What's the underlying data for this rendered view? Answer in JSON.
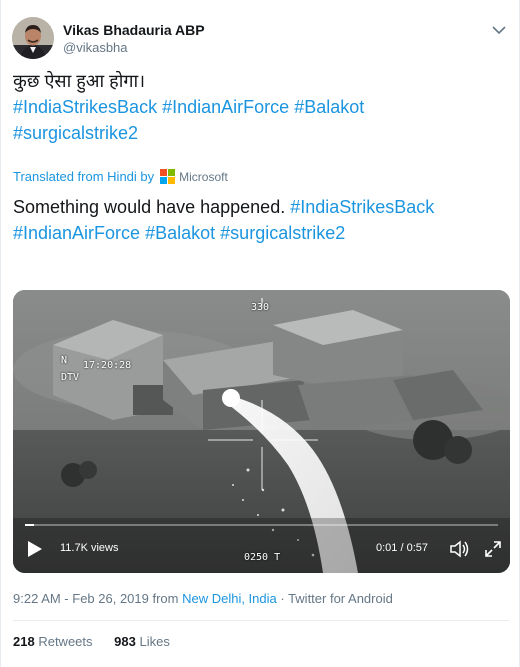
{
  "author": {
    "name": "Vikas Bhadauria ABP",
    "handle": "@vikasbha"
  },
  "tweet": {
    "text_line1": "कुछ ऐसा हुआ होगा।",
    "hashtags_line1": [
      "#IndiaStrikesBack",
      "#IndianAirForce",
      "#Balakot"
    ],
    "hashtags_line2": [
      "#surgicalstrike2"
    ]
  },
  "translation": {
    "label": "Translated from Hindi by",
    "provider": "Microsoft",
    "text_line1": "Something would have happened.",
    "hashtags_line1": [
      "#IndiaStrikesBack",
      "#IndianAirForce",
      "#Balakot"
    ],
    "hashtags_line2": [
      "#surgicalstrike2"
    ]
  },
  "video": {
    "overlay_heading": "330",
    "overlay_dir": "N",
    "overlay_clock": "17:20:28",
    "overlay_mode": "DTV",
    "overlay_bottom": "0250  T",
    "views": "11.7K views",
    "time": "0:01 / 0:57",
    "progress": 0.02
  },
  "meta": {
    "time": "9:22 AM - Feb 26, 2019 from ",
    "location": "New Delhi, India",
    "source": " · Twitter for Android"
  },
  "stats": {
    "retweets_count": "218",
    "retweets_label": "Retweets",
    "likes_count": "983",
    "likes_label": "Likes"
  },
  "colors": {
    "link": "#1b95e0",
    "muted": "#657786",
    "ms_red": "#f25022",
    "ms_green": "#7fba00",
    "ms_blue": "#00a4ef",
    "ms_yellow": "#ffb900"
  }
}
